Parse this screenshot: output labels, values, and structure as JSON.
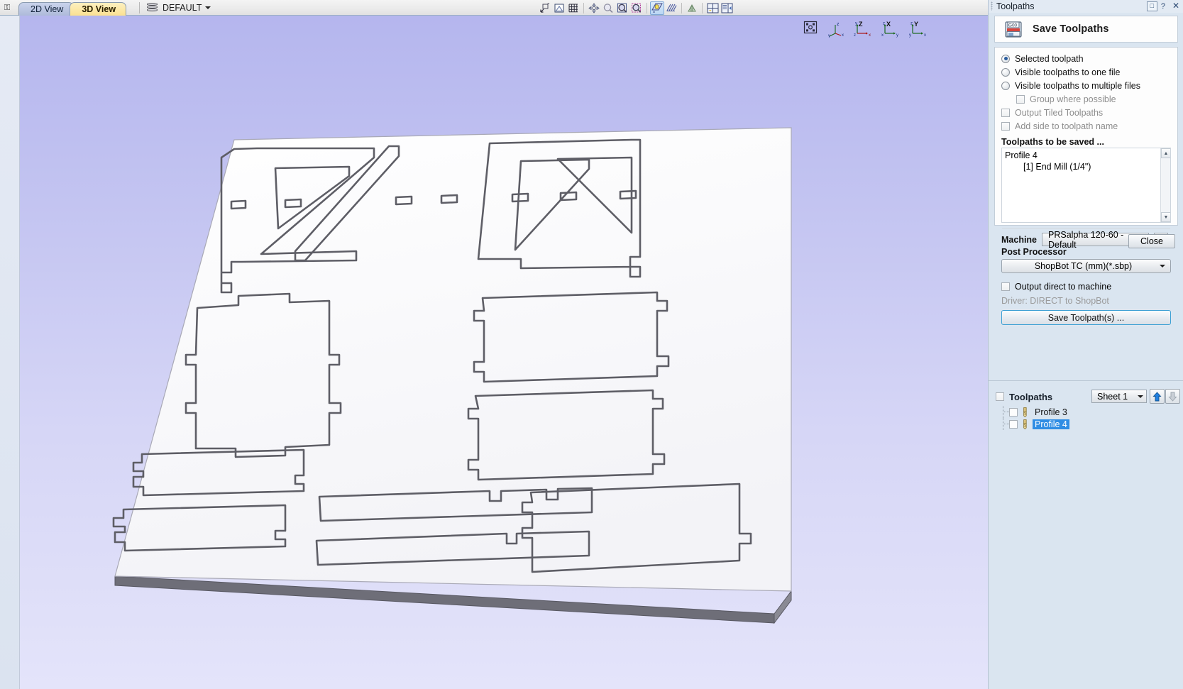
{
  "topbar": {
    "pin_icon": "pin-icon",
    "tabs": [
      {
        "label": "2D View",
        "active": false
      },
      {
        "label": "3D View",
        "active": true
      }
    ],
    "layer": {
      "label": "DEFAULT",
      "icon": "layers-stack-icon",
      "caret": "chevron-down-icon"
    },
    "tools": [
      {
        "name": "zoom-to-selection-icon"
      },
      {
        "name": "toggle-material-block-icon"
      },
      {
        "name": "toggle-grid-icon"
      },
      {
        "name": "pan-view-icon"
      },
      {
        "name": "zoom-out-icon"
      },
      {
        "name": "zoom-in-icon"
      },
      {
        "name": "zoom-window-icon"
      },
      {
        "name": "toggle-lighting-icon"
      },
      {
        "name": "toggle-toolpath-preview-icon"
      },
      {
        "name": "toggle-shaded-view-icon"
      },
      {
        "name": "two-view-layout-icon"
      },
      {
        "name": "split-view-layout-icon"
      }
    ]
  },
  "viewport": {
    "axis_indicators": [
      {
        "name": "iso-view-icon",
        "label": ""
      },
      {
        "name": "axis-iso-icon",
        "label": "Z"
      },
      {
        "name": "axis-z-icon",
        "label": "Z"
      },
      {
        "name": "axis-x-icon",
        "label": "X"
      },
      {
        "name": "axis-y-icon",
        "label": "Y"
      }
    ]
  },
  "panel": {
    "title": "Toolpaths",
    "help_icon": "help-icon",
    "question_icon": "question-icon",
    "close_icon": "close-icon",
    "header": {
      "icon": "save-floppy-icon",
      "title": "Save Toolpaths"
    },
    "output_mode": {
      "options": [
        {
          "label": "Selected toolpath",
          "selected": true
        },
        {
          "label": "Visible toolpaths to one file",
          "selected": false
        },
        {
          "label": "Visible toolpaths to multiple files",
          "selected": false
        }
      ],
      "group_where_possible": {
        "label": "Group where possible",
        "checked": false,
        "disabled": true
      }
    },
    "checkboxes": [
      {
        "label": "Output Tiled Toolpaths",
        "checked": false,
        "disabled": true
      },
      {
        "label": "Add side to toolpath name",
        "checked": false,
        "disabled": true
      }
    ],
    "toolpaths_to_be_saved": {
      "heading": "Toolpaths to be saved ...",
      "items": [
        "Profile 4",
        "[1] End Mill (1/4\")"
      ]
    },
    "machine": {
      "label": "Machine",
      "value": "PRSalpha 120-60 - Default",
      "edit_icon": "edit-machine-icon"
    },
    "post_processor": {
      "label": "Post Processor",
      "value": "ShopBot TC (mm)(*.sbp)"
    },
    "output_direct": {
      "label": "Output direct to machine",
      "checked": false,
      "driver_text": "Driver: DIRECT to ShopBot"
    },
    "save_button": "Save Toolpath(s) ...",
    "close_button": "Close"
  },
  "toolpaths_panel": {
    "title": "Toolpaths",
    "master_checkbox_checked": false,
    "sheet": {
      "value": "Sheet 1"
    },
    "move_up_icon": "arrow-up-icon",
    "move_down_icon": "arrow-down-icon",
    "items": [
      {
        "label": "Profile 3",
        "checked": false,
        "selected": false,
        "icon": "end-mill-icon"
      },
      {
        "label": "Profile 4",
        "checked": false,
        "selected": true,
        "icon": "end-mill-icon"
      }
    ]
  },
  "colors": {
    "viewport_bg_top": "#b5b6ee",
    "viewport_bg_bottom": "#e4e4fa",
    "panel_bg": "#dae5f0",
    "selection_blue": "#2f8de4",
    "accent_button_border": "#3da0d4",
    "tab_active_bg": "#fbe191",
    "material_fill": "#fdfdfd",
    "toolpath_line": "#5e5e66"
  }
}
